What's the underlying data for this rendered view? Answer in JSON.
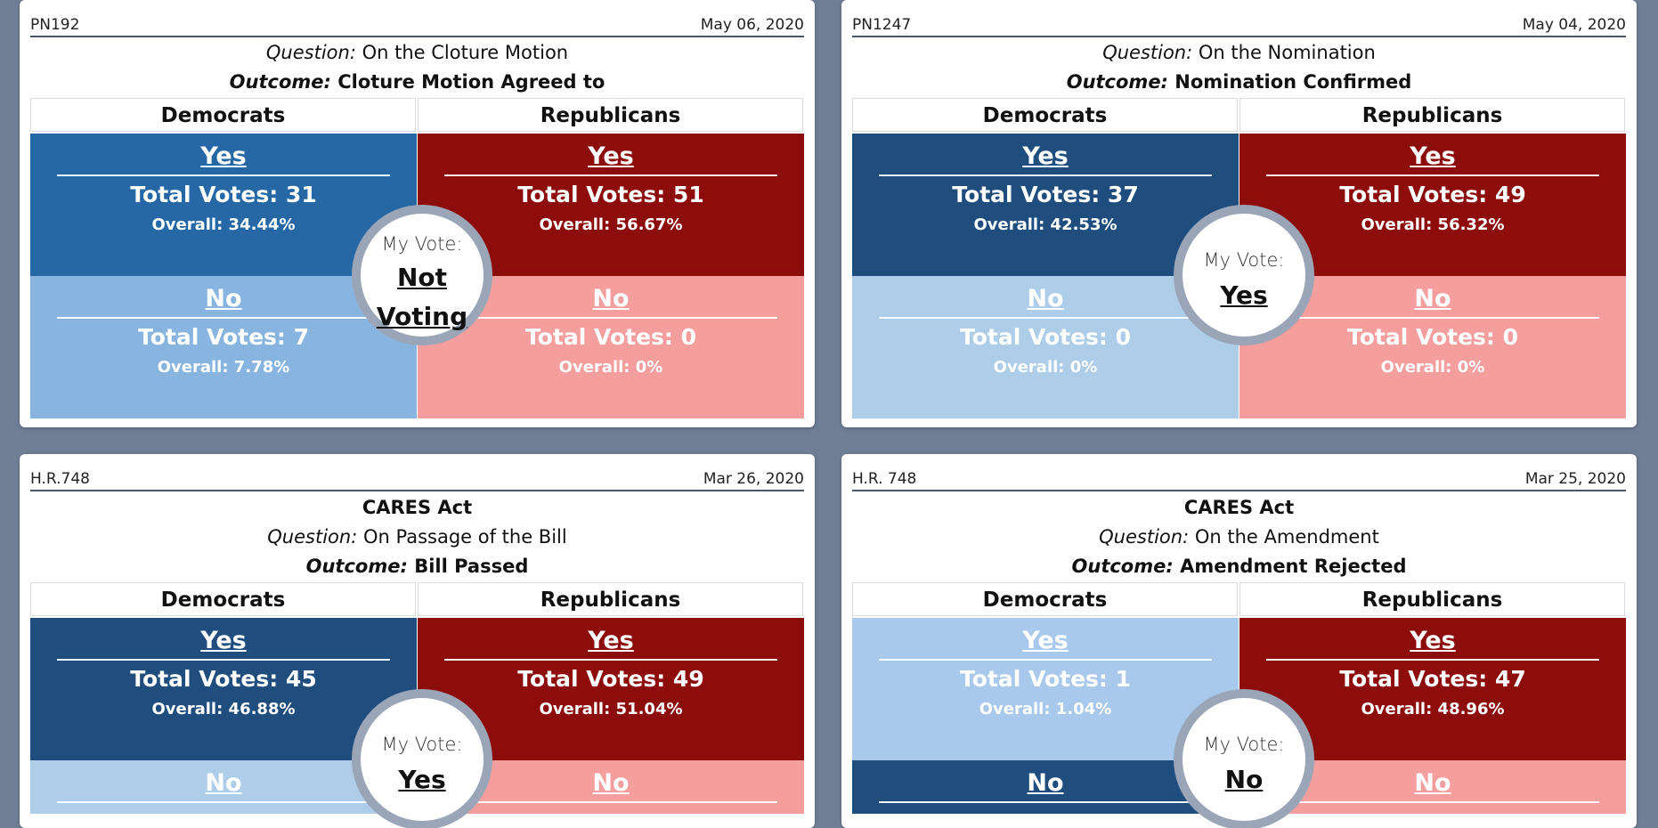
{
  "labels": {
    "democrats": "Democrats",
    "republicans": "Republicans",
    "question_key": "Question:",
    "outcome_key": "Outcome:",
    "my_vote": "My Vote:",
    "yes": "Yes",
    "no": "No"
  },
  "colors": {
    "dem_strong": "#1f4e7e",
    "dem_mid": "#2667a5",
    "dem_light": "#87b5e0",
    "dem_pale": "#aecde9",
    "rep_strong": "#8d0c0c",
    "rep_pale": "#f49e9e",
    "badge_ring": "#9aa6b8",
    "background": "#6f7d95"
  },
  "cards": [
    {
      "id": "PN192",
      "date": "May 06, 2020",
      "title": "",
      "question": "On the Cloture Motion",
      "outcome": "Cloture Motion Agreed to",
      "dem_yes_total": "Total Votes: 31",
      "dem_yes_overall": "Overall: 34.44%",
      "dem_no_total": "Total Votes: 7",
      "dem_no_overall": "Overall: 7.78%",
      "rep_yes_total": "Total Votes: 51",
      "rep_yes_overall": "Overall: 56.67%",
      "rep_no_total": "Total Votes: 0",
      "rep_no_overall": "Overall: 0%",
      "my_vote_line1": "Not",
      "my_vote_line2": "Voting"
    },
    {
      "id": "PN1247",
      "date": "May 04, 2020",
      "title": "",
      "question": "On the Nomination",
      "outcome": "Nomination Confirmed",
      "dem_yes_total": "Total Votes: 37",
      "dem_yes_overall": "Overall: 42.53%",
      "dem_no_total": "Total Votes: 0",
      "dem_no_overall": "Overall: 0%",
      "rep_yes_total": "Total Votes: 49",
      "rep_yes_overall": "Overall: 56.32%",
      "rep_no_total": "Total Votes: 0",
      "rep_no_overall": "Overall: 0%",
      "my_vote_line1": "Yes",
      "my_vote_line2": ""
    },
    {
      "id": "H.R.748",
      "date": "Mar 26, 2020",
      "title": "CARES Act",
      "question": "On Passage of the Bill",
      "outcome": "Bill Passed",
      "dem_yes_total": "Total Votes: 45",
      "dem_yes_overall": "Overall: 46.88%",
      "rep_yes_total": "Total Votes: 49",
      "rep_yes_overall": "Overall: 51.04%",
      "my_vote_line1": "Yes",
      "my_vote_line2": ""
    },
    {
      "id": "H.R. 748",
      "date": "Mar 25, 2020",
      "title": "CARES Act",
      "question": "On the Amendment",
      "outcome": "Amendment Rejected",
      "dem_yes_total": "Total Votes: 1",
      "dem_yes_overall": "Overall: 1.04%",
      "rep_yes_total": "Total Votes: 47",
      "rep_yes_overall": "Overall: 48.96%",
      "my_vote_line1": "No",
      "my_vote_line2": ""
    }
  ]
}
